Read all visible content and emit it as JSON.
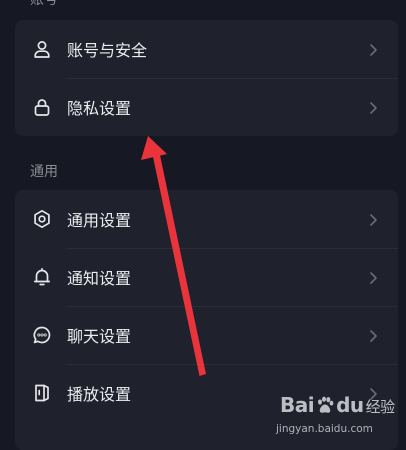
{
  "sections": [
    {
      "label": "账号",
      "items": [
        {
          "label": "账号与安全",
          "icon": "user-icon"
        },
        {
          "label": "隐私设置",
          "icon": "lock-icon"
        }
      ]
    },
    {
      "label": "通用",
      "items": [
        {
          "label": "通用设置",
          "icon": "gear-icon"
        },
        {
          "label": "通知设置",
          "icon": "bell-icon"
        },
        {
          "label": "聊天设置",
          "icon": "chat-bubble-icon"
        },
        {
          "label": "播放设置",
          "icon": "play-device-icon"
        }
      ]
    }
  ],
  "annotation": {
    "arrow_color": "#e8343a"
  },
  "watermark": {
    "logo_text_a": "Bai",
    "logo_text_b": "du",
    "logo_suffix": "经验",
    "url": "jingyan.baidu.com"
  },
  "colors": {
    "background": "#161823",
    "card": "#1f212c",
    "text": "#ececf0",
    "section_label": "#8a8b93"
  }
}
